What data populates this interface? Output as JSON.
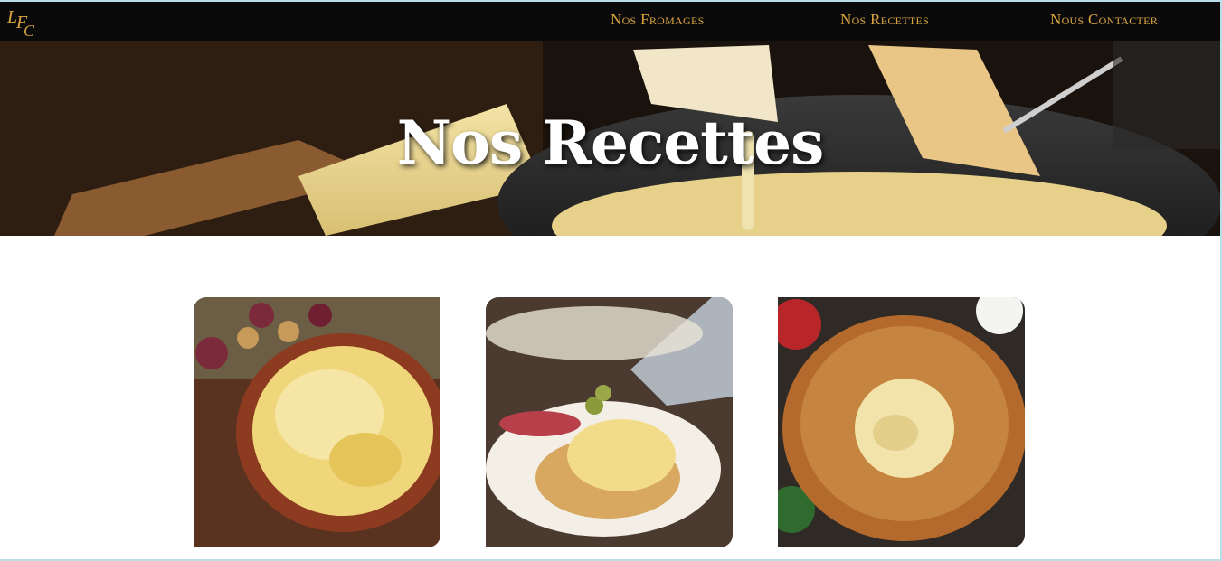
{
  "logo": {
    "text": "LFC",
    "color": "#d9a441"
  },
  "nav": {
    "links": [
      {
        "label": "Nos Fromages"
      },
      {
        "label": "Nos Recettes"
      },
      {
        "label": "Nous Contacter"
      }
    ]
  },
  "hero": {
    "title": "Nos Recettes"
  },
  "recipes": [
    {
      "image": "tartiflette-dish"
    },
    {
      "image": "raclette-potato"
    },
    {
      "image": "baked-camembert-bread-ring"
    }
  ],
  "colors": {
    "accent": "#d9a441",
    "navbar_bg": "#0a0a0a",
    "title": "#ffffff"
  }
}
